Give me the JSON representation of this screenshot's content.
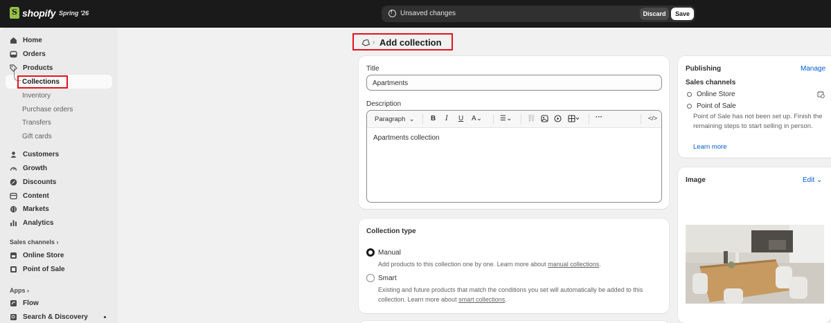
{
  "topbar": {
    "brand": "shopify",
    "release": "Spring '26",
    "unsaved_message": "Unsaved changes",
    "discard_label": "Discard",
    "save_label": "Save"
  },
  "sidebar": {
    "items": [
      {
        "label": "Home",
        "icon": "home-icon"
      },
      {
        "label": "Orders",
        "icon": "inbox-icon"
      },
      {
        "label": "Products",
        "icon": "tag-icon"
      }
    ],
    "product_sub": [
      "Collections",
      "Inventory",
      "Purchase orders",
      "Transfers",
      "Gift cards"
    ],
    "items2": [
      {
        "label": "Customers",
        "icon": "person-icon"
      },
      {
        "label": "Growth",
        "icon": "gauge-icon"
      },
      {
        "label": "Discounts",
        "icon": "discount-icon"
      },
      {
        "label": "Content",
        "icon": "content-icon"
      },
      {
        "label": "Markets",
        "icon": "globe-icon"
      },
      {
        "label": "Analytics",
        "icon": "bar-chart-icon"
      }
    ],
    "sales_channels_label": "Sales channels",
    "channels": [
      {
        "label": "Online Store",
        "icon": "store-icon"
      },
      {
        "label": "Point of Sale",
        "icon": "pos-icon"
      }
    ],
    "apps_label": "Apps",
    "apps": [
      {
        "label": "Flow",
        "icon": "flow-icon"
      },
      {
        "label": "Search & Discovery",
        "icon": "search-discovery-icon"
      }
    ]
  },
  "page": {
    "title": "Add collection"
  },
  "form": {
    "title_label": "Title",
    "title_value": "Apartments",
    "description_label": "Description",
    "paragraph_select": "Paragraph",
    "description_value": "Apartments collection"
  },
  "collection_type": {
    "heading": "Collection type",
    "manual_label": "Manual",
    "manual_help": "Add products to this collection one by one. Learn more about",
    "manual_link": "manual collections",
    "smart_label": "Smart",
    "smart_help": "Existing and future products that match the conditions you set will automatically be added to this collection. Learn more about",
    "smart_link": "smart collections",
    "selected": "Manual"
  },
  "publishing": {
    "heading": "Publishing",
    "manage_label": "Manage",
    "sales_channels_label": "Sales channels",
    "channels": [
      "Online Store",
      "Point of Sale"
    ],
    "pos_note": "Point of Sale has not been set up. Finish the remaining steps to start selling in person.",
    "learn_more": "Learn more"
  },
  "image_card": {
    "heading": "Image",
    "edit_label": "Edit"
  },
  "colors": {
    "topbar": "#1a1a1a",
    "link": "#005bd3",
    "highlight": "#e3121d"
  }
}
